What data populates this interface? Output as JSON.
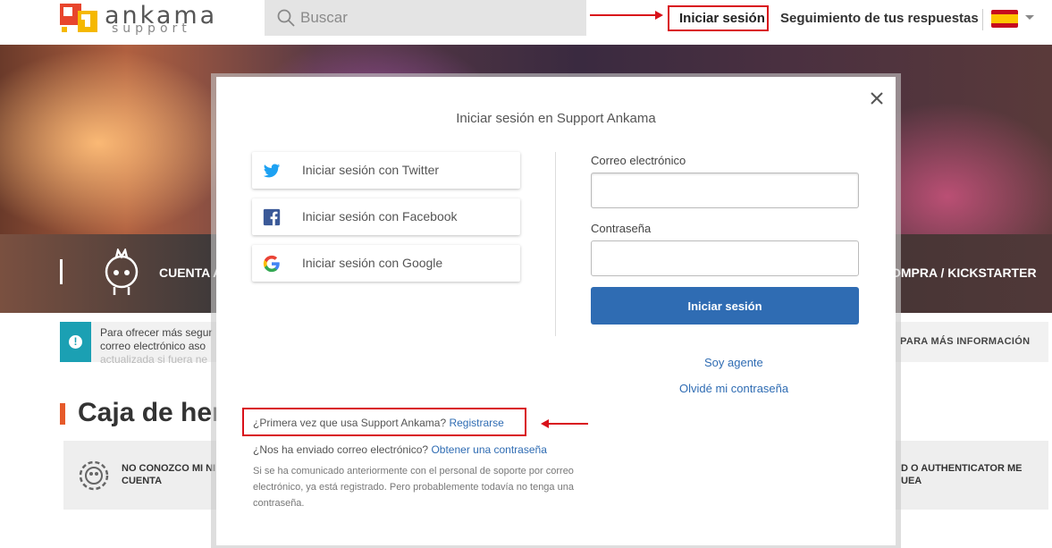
{
  "header": {
    "logo_word": "ankama",
    "logo_sub": "support",
    "search_placeholder": "Buscar",
    "login_label": "Iniciar sesión",
    "track_label": "Seguimiento de tus respuestas",
    "language_flag": "es-flag-icon"
  },
  "hero": {
    "band_left_label": "CUENTA A",
    "band_right_label": "OMPRA / KICKSTARTER"
  },
  "notice": {
    "text": "Para ofrecer más segur correo electrónico aso",
    "fade_text": "actualizada si fuera ne",
    "right_label": "PARA MÁS INFORMACIÓN"
  },
  "toolbox": {
    "title": "Caja de her",
    "card_left_label": "NO CONOZCO MI NI CUENTA",
    "card_right_label": "D O AUTHENTICATOR ME UEA"
  },
  "modal": {
    "title": "Iniciar sesión en Support Ankama",
    "twitter_label": "Iniciar sesión con Twitter",
    "facebook_label": "Iniciar sesión con Facebook",
    "google_label": "Iniciar sesión con Google",
    "email_label": "Correo electrónico",
    "email_value": "",
    "password_label": "Contraseña",
    "password_value": "",
    "submit_label": "Iniciar sesión",
    "agent_link": "Soy agente",
    "forgot_link": "Olvidé mi contraseña",
    "first_time_text": "¿Primera vez que usa Support Ankama?",
    "register_link": "Registrarse",
    "sent_text": "¿Nos ha enviado correo electrónico?",
    "get_password_link": "Obtener una contraseña",
    "note": "Si se ha comunicado anteriormente con el personal de soporte por correo electrónico, ya está registrado. Pero probablemente todavía no tenga una contraseña."
  },
  "colors": {
    "annotation_red": "#d9101a",
    "primary_blue": "#2f6cb3",
    "notice_teal": "#1ba0b3"
  }
}
